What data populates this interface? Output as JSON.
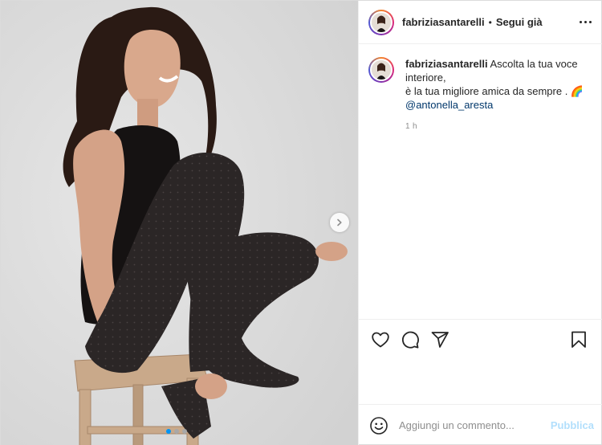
{
  "post": {
    "author": {
      "username": "fabriziasantarelli",
      "follow_separator": "•",
      "follow_label": "Segui già"
    },
    "more_icon": "more-horizontal-icon",
    "caption": {
      "username": "fabriziasantarelli",
      "line1": "Ascolta la tua voce interiore,",
      "line2": "è la tua migliore amica da sempre . 🌈",
      "mention": "@antonella_aresta"
    },
    "timestamp": "1 h",
    "carousel": {
      "slide_count": 3,
      "active_index": 0,
      "next_icon": "chevron-right-icon"
    },
    "actions": {
      "like_icon": "heart-icon",
      "comment_icon": "comment-bubble-icon",
      "share_icon": "paper-plane-icon",
      "save_icon": "bookmark-icon"
    },
    "add_comment": {
      "emoji_icon": "smiley-icon",
      "placeholder": "Aggiungi un commento...",
      "publish_label": "Pubblica"
    },
    "colors": {
      "link": "#00376b",
      "publish_disabled": "#b2dffc",
      "dot_active": "#0095f6",
      "muted": "#8e8e8e"
    }
  }
}
